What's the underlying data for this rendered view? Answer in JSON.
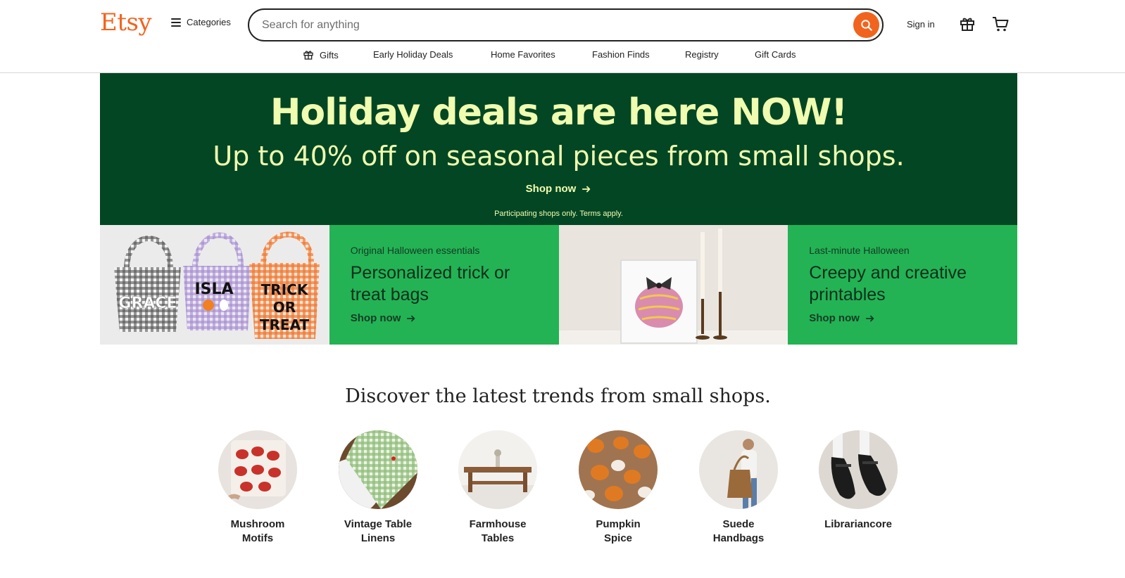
{
  "header": {
    "logo": "Etsy",
    "categories_label": "Categories",
    "search_placeholder": "Search for anything",
    "signin_label": "Sign in"
  },
  "nav": {
    "items": [
      {
        "label": "Gifts",
        "icon": "gift-icon"
      },
      {
        "label": "Early Holiday Deals"
      },
      {
        "label": "Home Favorites"
      },
      {
        "label": "Fashion Finds"
      },
      {
        "label": "Registry"
      },
      {
        "label": "Gift Cards"
      }
    ]
  },
  "banner": {
    "title": "Holiday deals are here NOW!",
    "subtitle": "Up to 40% off on seasonal pieces from small shops.",
    "cta": "Shop now",
    "terms": "Participating shops only. Terms apply."
  },
  "promos": [
    {
      "kicker": "Original Halloween essentials",
      "title": "Personalized trick or treat bags",
      "cta": "Shop now",
      "image_texts": [
        "GRACE",
        "ISLA",
        "TRICK",
        "OR",
        "TREAT"
      ]
    },
    {
      "kicker": "Last-minute Halloween",
      "title": "Creepy and creative printables",
      "cta": "Shop now"
    }
  ],
  "trends": {
    "heading": "Discover the latest trends from small shops.",
    "items": [
      {
        "label": "Mushroom Motifs",
        "line1": "Mushroom",
        "line2": "Motifs"
      },
      {
        "label": "Vintage Table Linens",
        "line1": "Vintage Table",
        "line2": "Linens"
      },
      {
        "label": "Farmhouse Tables",
        "line1": "Farmhouse",
        "line2": "Tables"
      },
      {
        "label": "Pumpkin Spice",
        "line1": "Pumpkin",
        "line2": "Spice"
      },
      {
        "label": "Suede Handbags",
        "line1": "Suede",
        "line2": "Handbags"
      },
      {
        "label": "Librariancore",
        "line1": "Librariancore",
        "line2": ""
      }
    ]
  },
  "colors": {
    "brand": "#f1641e",
    "banner_bg": "#034623",
    "banner_text": "#f0fdb0",
    "promo_bg": "#23b354"
  }
}
